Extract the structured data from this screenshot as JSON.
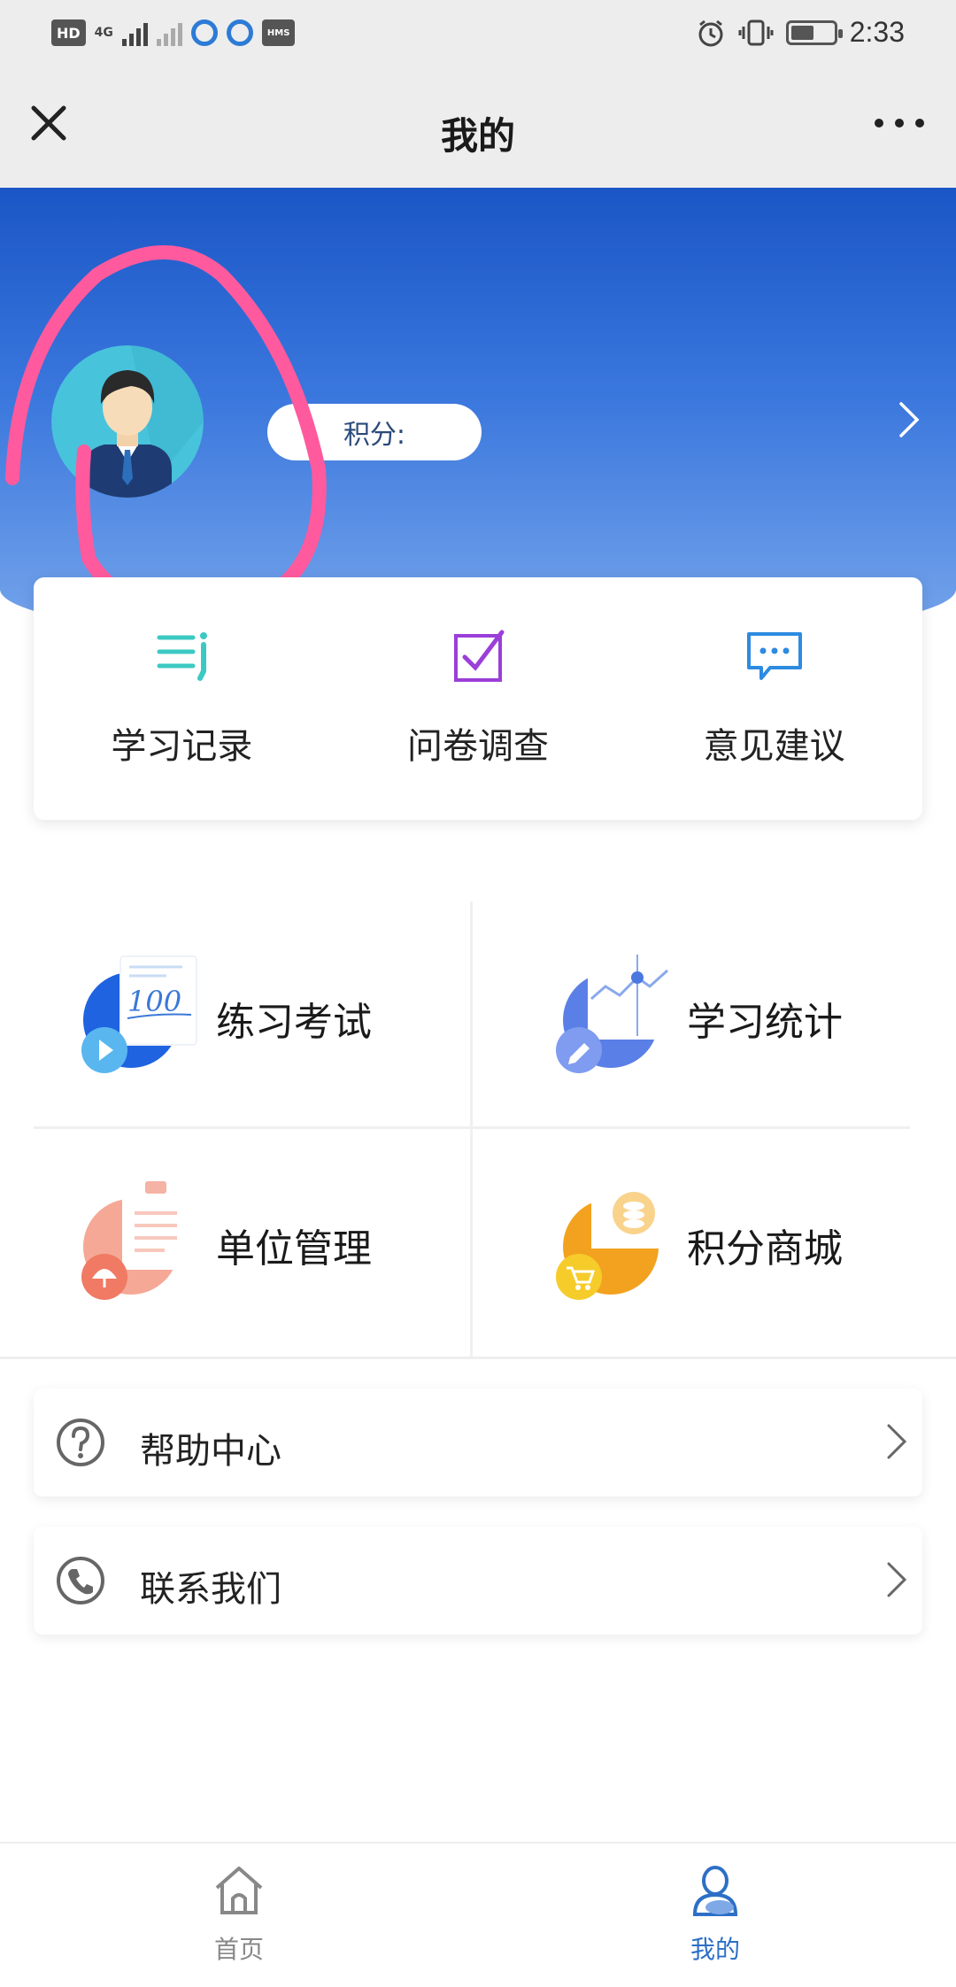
{
  "status_bar": {
    "network_chip": "HD",
    "sim_label": "4G",
    "hms_label": "HMS",
    "time": "2:33",
    "battery_level": 0.55
  },
  "nav": {
    "title": "我的"
  },
  "header": {
    "points_label": "积分:",
    "colors": {
      "gradient_top": "#1b56c6",
      "gradient_bottom": "#79a7ec",
      "annotation": "#ff5a9e"
    }
  },
  "quick_actions": [
    {
      "label": "学习记录",
      "icon": "study-record-icon",
      "color": "#3cc9c3"
    },
    {
      "label": "问卷调查",
      "icon": "survey-check-icon",
      "color": "#9b3fd8"
    },
    {
      "label": "意见建议",
      "icon": "feedback-chat-icon",
      "color": "#2d8be0"
    }
  ],
  "grid": [
    {
      "label": "练习考试",
      "icon": "practice-exam-icon"
    },
    {
      "label": "学习统计",
      "icon": "study-stats-icon"
    },
    {
      "label": "单位管理",
      "icon": "unit-management-icon"
    },
    {
      "label": "积分商城",
      "icon": "points-mall-icon"
    }
  ],
  "exam_icon_text": "100",
  "list": [
    {
      "label": "帮助中心",
      "icon": "help-icon"
    },
    {
      "label": "联系我们",
      "icon": "phone-icon"
    }
  ],
  "bottom_nav": [
    {
      "label": "首页",
      "icon": "home-icon",
      "active": false
    },
    {
      "label": "我的",
      "icon": "profile-icon",
      "active": true
    }
  ],
  "accent_color": "#2d6fc7"
}
